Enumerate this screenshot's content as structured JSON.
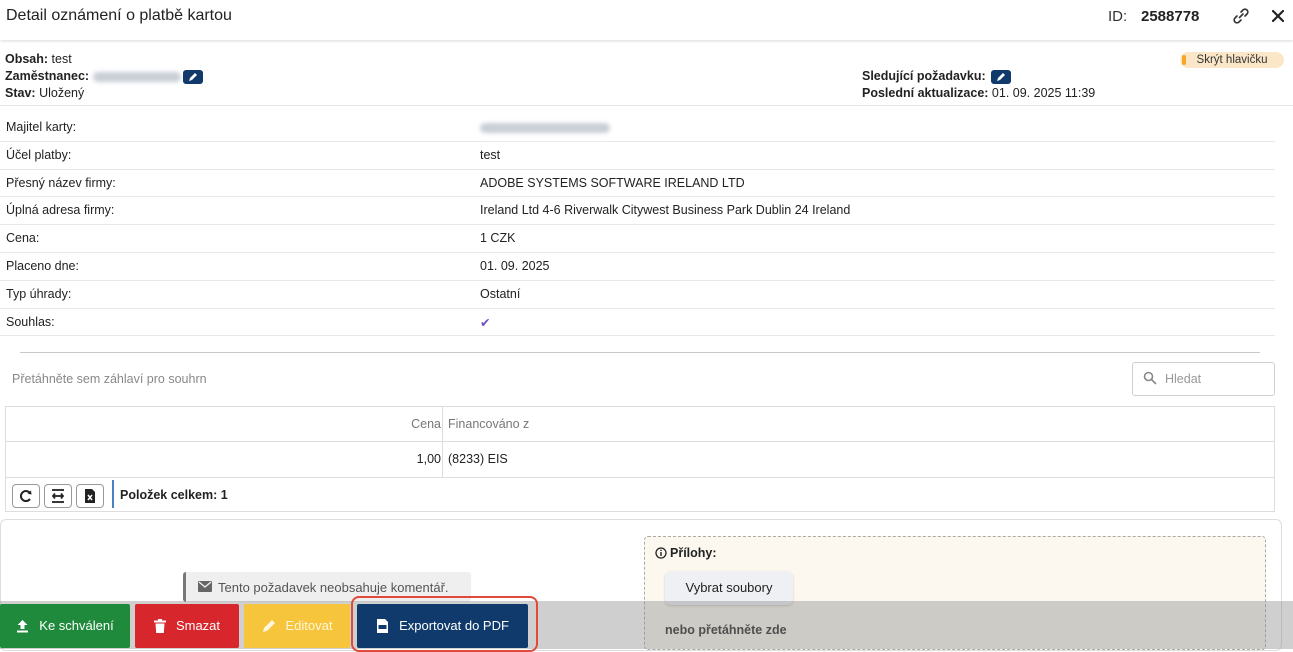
{
  "window": {
    "title": "Detail oznámení o platbě kartou",
    "id_label": "ID:",
    "id_value": "2588778"
  },
  "header": {
    "obsah_label": "Obsah:",
    "obsah_value": "test",
    "zamestnanec_label": "Zaměstnanec:",
    "stav_label": "Stav:",
    "stav_value": "Uložený",
    "sledujici_label": "Sledující požadavku:",
    "aktualizace_label": "Poslední aktualizace:",
    "aktualizace_value": "01. 09. 2025 11:39",
    "hide_header_label": "Skrýt hlavičku"
  },
  "details": [
    {
      "label": "Majitel karty:",
      "value": ""
    },
    {
      "label": "Účel platby:",
      "value": "test"
    },
    {
      "label": "Přesný název firmy:",
      "value": "ADOBE SYSTEMS SOFTWARE IRELAND LTD"
    },
    {
      "label": "Úplná adresa firmy:",
      "value": "Ireland Ltd 4-6 Riverwalk Citywest Business Park Dublin 24 Ireland"
    },
    {
      "label": "Cena:",
      "value": "1 CZK"
    },
    {
      "label": "Placeno dne:",
      "value": "01. 09. 2025"
    },
    {
      "label": "Typ úhrady:",
      "value": "Ostatní"
    },
    {
      "label": "Souhlas:",
      "value": "✔"
    }
  ],
  "grid": {
    "group_hint": "Přetáhněte sem záhlaví pro souhrn",
    "search_placeholder": "Hledat",
    "columns": [
      "Cena",
      "Financováno z"
    ],
    "rows": [
      [
        "1,00",
        "(8233) EIS"
      ]
    ],
    "total_label": "Položek celkem: 1"
  },
  "comments": {
    "empty_text": "Tento požadavek neobsahuje komentář."
  },
  "attachments": {
    "label": "Přílohy:",
    "pick_button": "Vybrat soubory",
    "drop_hint": "nebo přetáhněte zde"
  },
  "actions": {
    "approve": "Ke schválení",
    "delete": "Smazat",
    "edit": "Editovat",
    "export": "Exportovat do PDF"
  },
  "colors": {
    "approve": "#1f8a3b",
    "delete": "#d7262c",
    "edit": "#f7c53b",
    "export": "#0f3a6b",
    "highlight": "#e04a3a"
  }
}
